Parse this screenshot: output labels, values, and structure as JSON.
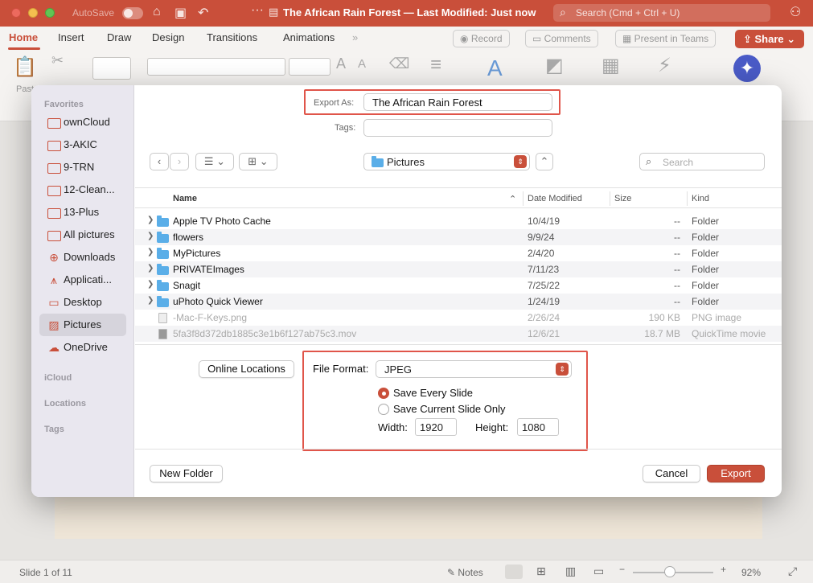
{
  "window": {
    "autosave_label": "AutoSave",
    "doc_title": "The African Rain Forest — Last Modified: Just now",
    "search_placeholder": "Search (Cmd + Ctrl + U)"
  },
  "ribbon_tabs": [
    "Home",
    "Insert",
    "Draw",
    "Design",
    "Transitions",
    "Animations"
  ],
  "ribbon_actions": {
    "record": "Record",
    "comments": "Comments",
    "present_teams": "Present in Teams",
    "share": "Share"
  },
  "ribbon": {
    "paste_label": "Past"
  },
  "dialog": {
    "export_as_label": "Export As:",
    "export_as_value": "The African Rain Forest",
    "tags_label": "Tags:",
    "tags_value": "",
    "location": "Pictures",
    "search_placeholder": "Search",
    "columns": {
      "name": "Name",
      "date": "Date Modified",
      "size": "Size",
      "kind": "Kind"
    },
    "rows": [
      {
        "name": "Apple TV Photo Cache",
        "date": "10/4/19",
        "size": "--",
        "kind": "Folder"
      },
      {
        "name": "flowers",
        "date": "9/9/24",
        "size": "--",
        "kind": "Folder"
      },
      {
        "name": "MyPictures",
        "date": "2/4/20",
        "size": "--",
        "kind": "Folder"
      },
      {
        "name": "PRIVATEImages",
        "date": "7/11/23",
        "size": "--",
        "kind": "Folder"
      },
      {
        "name": "Snagit",
        "date": "7/25/22",
        "size": "--",
        "kind": "Folder"
      },
      {
        "name": "uPhoto Quick Viewer",
        "date": "1/24/19",
        "size": "--",
        "kind": "Folder"
      },
      {
        "name": "-Mac-F-Keys.png",
        "date": "2/26/24",
        "size": "190 KB",
        "kind": "PNG image"
      },
      {
        "name": "5fa3f8d372db1885c3e1b6f127ab75c3.mov",
        "date": "12/6/21",
        "size": "18.7 MB",
        "kind": "QuickTime movie"
      }
    ],
    "online_locations": "Online Locations",
    "file_format_label": "File Format:",
    "file_format_value": "JPEG",
    "save_every": "Save Every Slide",
    "save_current": "Save Current Slide Only",
    "width_label": "Width:",
    "width_value": "1920",
    "height_label": "Height:",
    "height_value": "1080",
    "new_folder": "New Folder",
    "cancel": "Cancel",
    "export": "Export"
  },
  "sidebar": {
    "favorites_label": "Favorites",
    "items": [
      {
        "label": "ownCloud",
        "icon": "folder-icon"
      },
      {
        "label": "3-AKIC",
        "icon": "folder-icon"
      },
      {
        "label": "9-TRN",
        "icon": "folder-icon"
      },
      {
        "label": "12-Clean...",
        "icon": "folder-icon"
      },
      {
        "label": "13-Plus",
        "icon": "folder-icon"
      },
      {
        "label": "All pictures",
        "icon": "folder-icon"
      },
      {
        "label": "Downloads",
        "icon": "download-icon"
      },
      {
        "label": "Applicati...",
        "icon": "applications-icon"
      },
      {
        "label": "Desktop",
        "icon": "desktop-icon"
      },
      {
        "label": "Pictures",
        "icon": "pictures-icon"
      },
      {
        "label": "OneDrive",
        "icon": "cloud-icon"
      }
    ],
    "icloud_label": "iCloud",
    "locations_label": "Locations",
    "tags_label": "Tags"
  },
  "status": {
    "slide_counter": "Slide 1 of 11",
    "notes": "Notes",
    "zoom": "92%"
  },
  "colors": {
    "accent": "#c94f3a",
    "highlight": "#e0554a",
    "folder_blue": "#5aaee8"
  }
}
